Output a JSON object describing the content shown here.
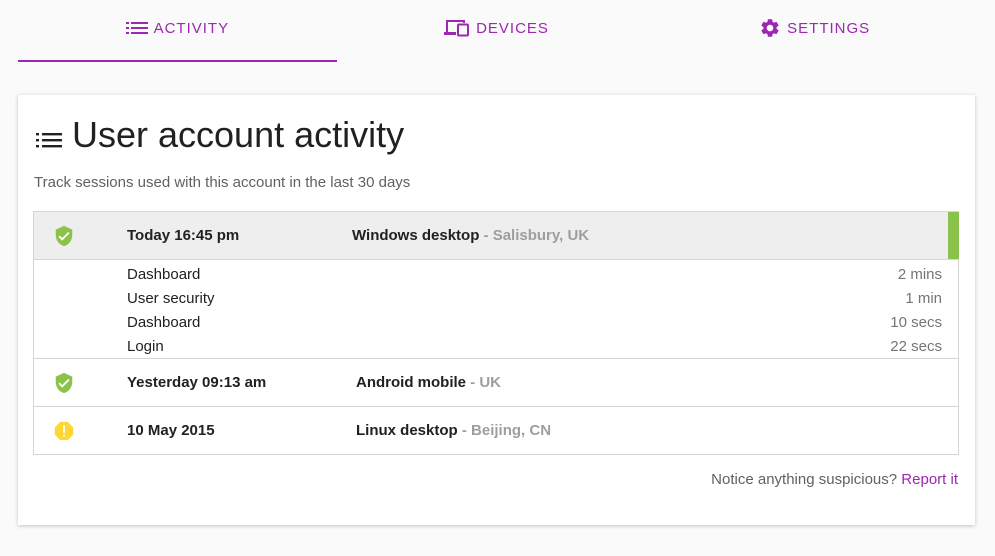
{
  "tabs": [
    {
      "label": "ACTIVITY",
      "icon": "list-icon",
      "active": true
    },
    {
      "label": "DEVICES",
      "icon": "devices-icon",
      "active": false
    },
    {
      "label": "SETTINGS",
      "icon": "gear-icon",
      "active": false
    }
  ],
  "card": {
    "title": "User account activity",
    "subtitle": "Track sessions used with this account in the last 30 days"
  },
  "sessions": [
    {
      "status": "secure",
      "status_icon": "shield-check-icon",
      "time": "Today 16:45 pm",
      "device": "Windows desktop",
      "location": " - Salisbury, UK",
      "expanded": true,
      "details": [
        {
          "page": "Dashboard",
          "duration": "2 mins"
        },
        {
          "page": "User security",
          "duration": "1 min"
        },
        {
          "page": "Dashboard",
          "duration": "10 secs"
        },
        {
          "page": "Login",
          "duration": "22 secs"
        }
      ]
    },
    {
      "status": "secure",
      "status_icon": "shield-check-icon",
      "time": "Yesterday 09:13 am",
      "device": "Android mobile",
      "location": " - UK",
      "expanded": false
    },
    {
      "status": "warning",
      "status_icon": "warning-icon",
      "time": "10 May 2015",
      "device": "Linux desktop",
      "location": " - Beijing, CN",
      "expanded": false
    }
  ],
  "footer": {
    "question": "Notice anything suspicious?",
    "link_label": "Report it"
  },
  "colors": {
    "accent": "#9c27b0",
    "secure": "#8bc34a",
    "warning": "#fdd835"
  }
}
